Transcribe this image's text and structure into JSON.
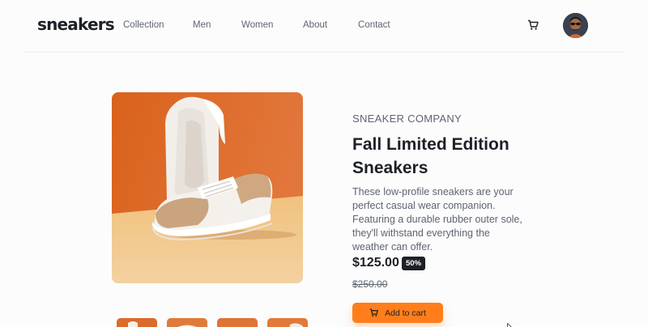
{
  "header": {
    "logo": "sneakers",
    "nav": [
      "Collection",
      "Men",
      "Women",
      "About",
      "Contact"
    ],
    "cart_icon": "cart-icon",
    "avatar_icon": "avatar-icon"
  },
  "product": {
    "company": "SNEAKER COMPANY",
    "title": "Fall Limited Edition Sneakers",
    "description": "These low-profile sneakers are your perfect casual wear companion. Featuring a durable rubber outer sole, they'll withstand everything the weather can offer.",
    "price": "$125.00",
    "discount": "50%",
    "old_price": "$250.00",
    "add_to_cart": "Add to cart"
  },
  "colors": {
    "accent": "#ff7e1b",
    "dark": "#1d2026",
    "muted": "#5f6471",
    "image_background": "#e07d3e"
  }
}
